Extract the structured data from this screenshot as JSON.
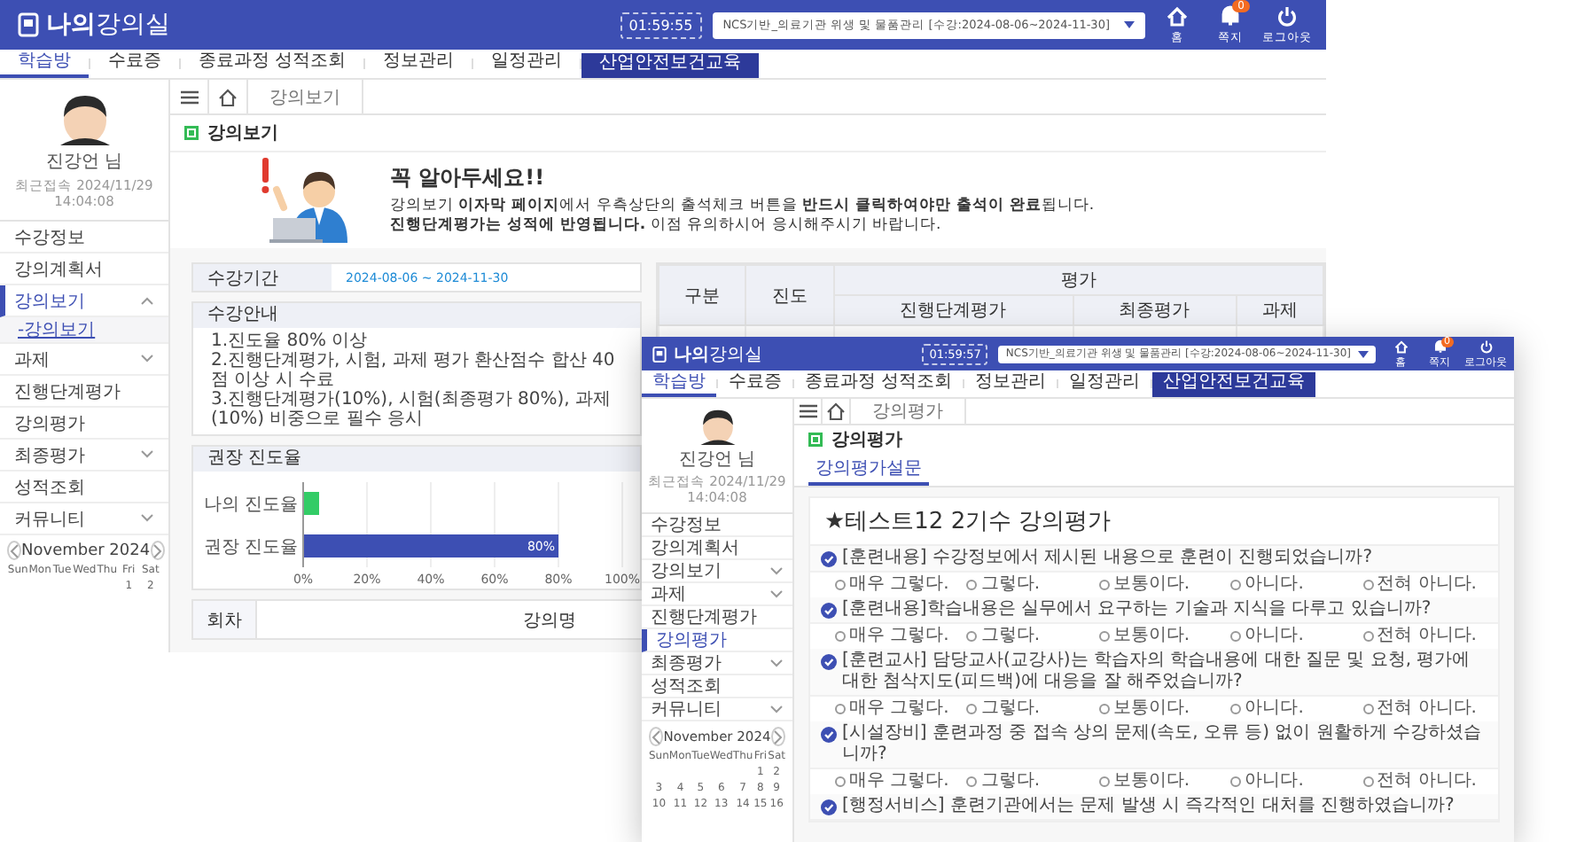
{
  "main": {
    "header": {
      "logo": "**나의**강의실",
      "timer": "01:59:55",
      "course_select": "NCS기반_의료기관 위생 및 물품관리 [수강:2024-08-06~2024-11-30]",
      "actions": [
        {
          "kind": "home",
          "label": "홈"
        },
        {
          "kind": "message",
          "label": "쪽지",
          "badge": "0"
        },
        {
          "kind": "logout",
          "label": "로그아웃"
        }
      ]
    },
    "nav": [
      {
        "label": "학습방",
        "selected": true,
        "highlight": false
      },
      {
        "label": "수료증",
        "selected": false,
        "highlight": false
      },
      {
        "label": "종료과정 성적조회",
        "selected": false,
        "highlight": false
      },
      {
        "label": "정보관리",
        "selected": false,
        "highlight": false
      },
      {
        "label": "일정관리",
        "selected": false,
        "highlight": false
      },
      {
        "label": "산업안전보건교육",
        "selected": false,
        "highlight": true
      }
    ],
    "sidebar": {
      "user": "진강언 님",
      "last_login": "최근접속 2024/11/29 14:04:08",
      "menu": [
        {
          "label": "수강정보",
          "expandable": false,
          "selected": false
        },
        {
          "label": "강의계획서",
          "expandable": false,
          "selected": false
        },
        {
          "label": "강의보기",
          "expandable": true,
          "expanded": true,
          "selected": true,
          "children": [
            {
              "label": "-강의보기",
              "selected": true
            }
          ]
        },
        {
          "label": "과제",
          "expandable": true,
          "expanded": false,
          "selected": false
        },
        {
          "label": "진행단계평가",
          "expandable": false,
          "selected": false
        },
        {
          "label": "강의평가",
          "expandable": false,
          "selected": false
        },
        {
          "label": "최종평가",
          "expandable": true,
          "expanded": false,
          "selected": false
        },
        {
          "label": "성적조회",
          "expandable": false,
          "selected": false
        },
        {
          "label": "커뮤니티",
          "expandable": true,
          "expanded": false,
          "selected": false
        }
      ],
      "calendar": {
        "title": "November 2024",
        "weekdays": [
          "Sun",
          "Mon",
          "Tue",
          "Wed",
          "Thu",
          "Fri",
          "Sat"
        ],
        "weeks": [
          {
            "align_end": true,
            "days": [
              "1",
              "2"
            ]
          }
        ]
      }
    },
    "content": {
      "breadcrumb": "강의보기",
      "title": "강의보기",
      "notice": {
        "heading": "꼭 알아두세요!!",
        "lines": [
          "강의보기 **이자막 페이지**에서 우측상단의 출석체크 버튼을 **반드시 클릭하여야만 출석이 완료**됩니다.",
          "**진행단계평가는 성적에 반영됩니다.** 이점 유의하시어 응시해주시기 바랍니다."
        ]
      },
      "period": {
        "label": "수강기간",
        "value": "2024-08-06 ~ 2024-11-30"
      },
      "guide": {
        "title": "수강안내",
        "lines": [
          "1.진도율 80% 이상",
          "2.진행단계평가, 시험, 과제 평가 환산점수 합산 40점 이상 시 수료",
          "3.진행단계평가(10%), 시험(최종평가 80%), 과제(10%) 비중으로 필수 응시"
        ]
      },
      "progress": {
        "title": "권장 진도율",
        "chart_data": {
          "type": "bar",
          "orientation": "horizontal",
          "grid": true,
          "categories": [
            "나의 진도율",
            "권장 진도율"
          ],
          "values": [
            5,
            80
          ],
          "colors": [
            "#33cc66",
            "#3d4fb3"
          ],
          "xlim": [
            0,
            100
          ],
          "xticks": [
            {
              "value": 0,
              "label": "0%"
            },
            {
              "value": 20,
              "label": "20%"
            },
            {
              "value": 40,
              "label": "40%"
            },
            {
              "value": 60,
              "label": "60%"
            },
            {
              "value": 80,
              "label": "80%"
            },
            {
              "value": 100,
              "label": "100%"
            }
          ],
          "value_labels": [
            null,
            "80%"
          ]
        }
      },
      "summary_table": {
        "columns": [
          "구분",
          "진도",
          "평가"
        ],
        "subcolumns": [
          "진행단계평가",
          "최종평가",
          "과제"
        ]
      },
      "lecture_table": {
        "columns": [
          "회차",
          "강의명"
        ]
      }
    }
  },
  "inset": {
    "header": {
      "logo": "**나의**강의실",
      "timer": "01:59:57",
      "course_select": "NCS기반_의료기관 위생 및 물품관리 [수강:2024-08-06~2024-11-30]",
      "actions": [
        {
          "kind": "home",
          "label": "홈"
        },
        {
          "kind": "message",
          "label": "쪽지",
          "badge": "0"
        },
        {
          "kind": "logout",
          "label": "로그아웃"
        }
      ]
    },
    "nav": [
      {
        "label": "학습방",
        "selected": true,
        "highlight": false
      },
      {
        "label": "수료증",
        "selected": false,
        "highlight": false
      },
      {
        "label": "종료과정 성적조회",
        "selected": false,
        "highlight": false
      },
      {
        "label": "정보관리",
        "selected": false,
        "highlight": false
      },
      {
        "label": "일정관리",
        "selected": false,
        "highlight": false
      },
      {
        "label": "산업안전보건교육",
        "selected": false,
        "highlight": true
      }
    ],
    "sidebar": {
      "user": "진강언 님",
      "last_login": "최근접속 2024/11/29 14:04:08",
      "menu": [
        {
          "label": "수강정보",
          "expandable": false,
          "selected": false
        },
        {
          "label": "강의계획서",
          "expandable": false,
          "selected": false
        },
        {
          "label": "강의보기",
          "expandable": true,
          "expanded": false,
          "selected": false
        },
        {
          "label": "과제",
          "expandable": true,
          "expanded": false,
          "selected": false
        },
        {
          "label": "진행단계평가",
          "expandable": false,
          "selected": false
        },
        {
          "label": "강의평가",
          "expandable": false,
          "selected": true
        },
        {
          "label": "최종평가",
          "expandable": true,
          "expanded": false,
          "selected": false
        },
        {
          "label": "성적조회",
          "expandable": false,
          "selected": false
        },
        {
          "label": "커뮤니티",
          "expandable": true,
          "expanded": false,
          "selected": false
        }
      ],
      "calendar": {
        "title": "November 2024",
        "weekdays": [
          "Sun",
          "Mon",
          "Tue",
          "Wed",
          "Thu",
          "Fri",
          "Sat"
        ],
        "weeks": [
          {
            "align_end": true,
            "days": [
              "1",
              "2"
            ]
          },
          {
            "days": [
              "3",
              "4",
              "5",
              "6",
              "7",
              "8",
              "9"
            ]
          },
          {
            "days": [
              "10",
              "11",
              "12",
              "13",
              "14",
              "15",
              "16"
            ]
          }
        ]
      }
    },
    "content": {
      "breadcrumb": "강의평가",
      "title": "강의평가",
      "tabs": [
        {
          "label": "강의평가설문",
          "selected": true
        }
      ],
      "survey": {
        "title": "★테스트12 2기수 강의평가",
        "questions": [
          {
            "text": "[훈련내용] 수강정보에서 제시된 내용으로 훈련이 진행되었습니까?",
            "options": [
              {
                "label": "매우 그렇다.",
                "selected": false
              },
              {
                "label": "그렇다.",
                "selected": false
              },
              {
                "label": "보통이다.",
                "selected": false
              },
              {
                "label": "아니다.",
                "selected": false
              },
              {
                "label": "전혀 아니다.",
                "selected": false
              }
            ]
          },
          {
            "text": "[훈련내용]학습내용은 실무에서 요구하는 기술과 지식을 다루고 있습니까?",
            "options": [
              {
                "label": "매우 그렇다.",
                "selected": false
              },
              {
                "label": "그렇다.",
                "selected": false
              },
              {
                "label": "보통이다.",
                "selected": false
              },
              {
                "label": "아니다.",
                "selected": false
              },
              {
                "label": "전혀 아니다.",
                "selected": false
              }
            ]
          },
          {
            "text": "[훈련교사] 담당교사(교강사)는 학습자의 학습내용에 대한 질문 및 요청, 평가에 대한 첨삭지도(피드백)에 대응을 잘 해주었습니까?",
            "options": [
              {
                "label": "매우 그렇다.",
                "selected": false
              },
              {
                "label": "그렇다.",
                "selected": false
              },
              {
                "label": "보통이다.",
                "selected": false
              },
              {
                "label": "아니다.",
                "selected": false
              },
              {
                "label": "전혀 아니다.",
                "selected": false
              }
            ]
          },
          {
            "text": "[시설장비] 훈련과정 중 접속 상의 문제(속도, 오류 등) 없이 원활하게 수강하셨습니까?",
            "options": [
              {
                "label": "매우 그렇다.",
                "selected": false
              },
              {
                "label": "그렇다.",
                "selected": false
              },
              {
                "label": "보통이다.",
                "selected": false
              },
              {
                "label": "아니다.",
                "selected": false
              },
              {
                "label": "전혀 아니다.",
                "selected": false
              }
            ]
          },
          {
            "text": "[행정서비스] 훈련기관에서는 문제 발생 시 즉각적인 대처를 진행하였습니까?"
          }
        ]
      }
    }
  }
}
